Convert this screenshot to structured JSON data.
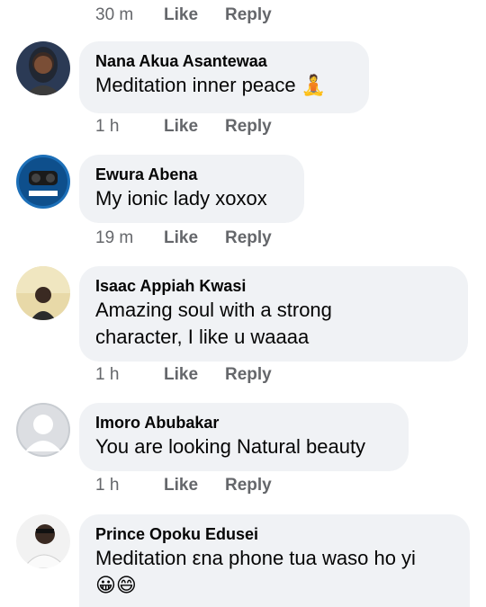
{
  "top_meta": {
    "time": "30 m",
    "like": "Like",
    "reply": "Reply"
  },
  "comments": [
    {
      "name": "Nana Akua Asantewaa",
      "text": "Meditation inner peace",
      "emoji": "🧘",
      "time": "1 h",
      "like": "Like",
      "reply": "Reply"
    },
    {
      "name": "Ewura Abena",
      "text": "My ionic lady xoxox",
      "time": "19 m",
      "like": "Like",
      "reply": "Reply"
    },
    {
      "name": "Isaac Appiah Kwasi",
      "text_line1": "Amazing soul with a strong",
      "text_line2": "character, I like u waaaa",
      "time": "1 h",
      "like": "Like",
      "reply": "Reply"
    },
    {
      "name": "Imoro Abubakar",
      "text": "You are looking Natural beauty",
      "time": "1 h",
      "like": "Like",
      "reply": "Reply"
    },
    {
      "name": "Prince Opoku Edusei",
      "text": "Meditation εna phone tua waso ho yi",
      "emoji": "😀😄"
    }
  ],
  "colors": {
    "bubble": "#f0f2f5",
    "meta": "#65676b",
    "text": "#050505"
  }
}
